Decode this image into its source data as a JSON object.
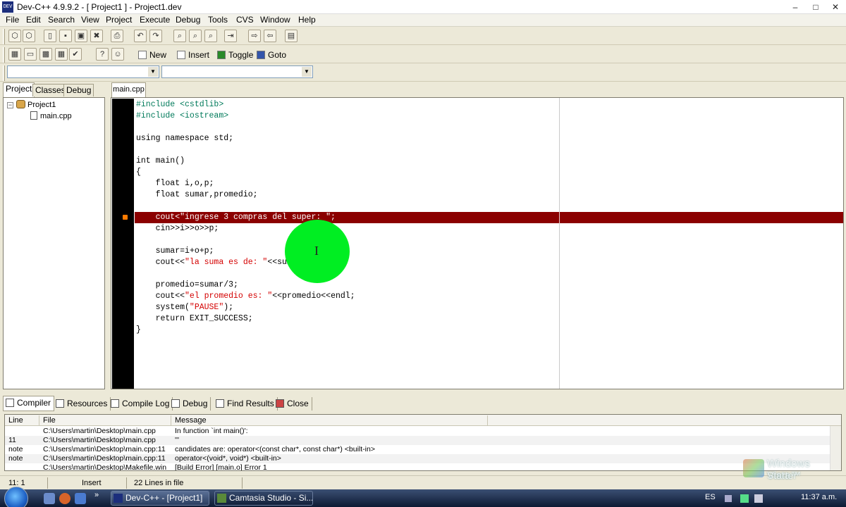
{
  "window": {
    "title": "Dev-C++ 4.9.9.2  - [ Project1 ] - Project1.dev",
    "app_icon_label": "DEV",
    "min_glyph": "–",
    "max_glyph": "□",
    "close_glyph": "✕"
  },
  "menu": [
    "File",
    "Edit",
    "Search",
    "View",
    "Project",
    "Execute",
    "Debug",
    "Tools",
    "CVS",
    "Window",
    "Help"
  ],
  "toolbar2": {
    "new_label": "New",
    "insert_label": "Insert",
    "toggle_label": "Toggle",
    "goto_label": "Goto"
  },
  "project_panel": {
    "tabs": [
      "Project",
      "Classes",
      "Debug"
    ],
    "active_tab": "Project",
    "tree": {
      "project_name": "Project1",
      "files": [
        "main.cpp"
      ]
    }
  },
  "editor": {
    "tab": "main.cpp",
    "lines": [
      "#include <cstdlib>",
      "#include <iostream>",
      "",
      "using namespace std;",
      "",
      "int main()",
      "{",
      "    float i,o,p;",
      "    float sumar,promedio;",
      "",
      "    cout<\"ingrese 3 compras del super: \";",
      "    cin>>i>>o>>p;",
      "",
      "    sumar=i+o+p;",
      "    cout<<\"la suma es de: \"<<sumar<<endl;",
      "",
      "    promedio=sumar/3;",
      "    cout<<\"el promedio es: \"<<promedio<<endl;",
      "    system(\"PAUSE\");",
      "    return EXIT_SUCCESS;",
      "}"
    ],
    "error_line": 11,
    "highlight_color": "#8b0000",
    "cursor_highlight_color": "#00ee22"
  },
  "bottom_tabs": [
    "Compiler",
    "Resources",
    "Compile Log",
    "Debug",
    "Find Results",
    "Close"
  ],
  "active_bottom_tab": "Compiler",
  "log": {
    "headers": [
      "Line",
      "File",
      "Message"
    ],
    "rows": [
      {
        "line": "",
        "file": "C:\\Users\\martin\\Desktop\\main.cpp",
        "message": "In function `int main()':"
      },
      {
        "line": "11",
        "file": "C:\\Users\\martin\\Desktop\\main.cpp",
        "message": "'''"
      },
      {
        "line": "note",
        "file": "C:\\Users\\martin\\Desktop\\main.cpp:11",
        "message": "candidates are: operator<(const char*, const char*) <built-in>"
      },
      {
        "line": "note",
        "file": "C:\\Users\\martin\\Desktop\\main.cpp:11",
        "message": "                operator<(void*, void*) <built-in>"
      },
      {
        "line": "",
        "file": "C:\\Users\\martin\\Desktop\\Makefile.win",
        "message": "[Build Error]  [main.o] Error 1"
      }
    ]
  },
  "status": {
    "position": "11: 1",
    "mode": "Insert",
    "info": "22 Lines in file"
  },
  "watermark": {
    "line1": "Windows Vista™",
    "line2": "Starter"
  },
  "taskbar": {
    "tasks": [
      "Dev-C++ - [Project1]",
      "Camtasia Studio - Si..."
    ],
    "language": "ES",
    "clock": "11:37 a.m.",
    "overflow_glyph": "»"
  }
}
